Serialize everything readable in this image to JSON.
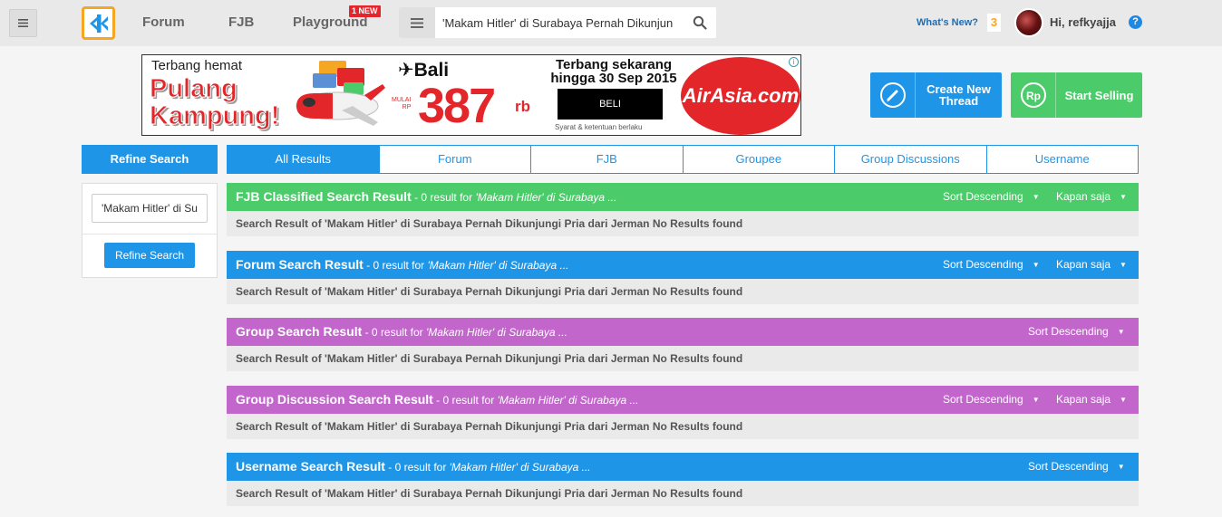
{
  "header": {
    "nav": [
      {
        "label": "Forum"
      },
      {
        "label": "FJB"
      },
      {
        "label": "Playground"
      }
    ],
    "new_badge": "1 NEW",
    "search_value": "'Makam Hitler' di Surabaya Pernah Dikunjun",
    "whats_new": "What's New?",
    "notification_count": "3",
    "greeting": "Hi, refkyajja",
    "help": "?"
  },
  "ad": {
    "tagline": "Terbang hemat",
    "headline_1": "Pulang",
    "headline_2": "Kampung!",
    "destination": "✈Bali",
    "mulai_1": "MULAI",
    "mulai_2": "RP",
    "price": "387",
    "price_unit": "rb",
    "promo_1": "Terbang sekarang",
    "promo_2": "hingga 30 Sep 2015",
    "cta": "BELI",
    "terms": "Syarat & ketentuan berlaku",
    "brand": "AirAsia.com",
    "info": "i"
  },
  "actions": {
    "create_line1": "Create New",
    "create_line2": "Thread",
    "sell": "Start Selling",
    "sell_icon_text": "Rp"
  },
  "sidebar": {
    "header": "Refine Search",
    "input_value": "'Makam Hitler' di Surabaya",
    "button": "Refine Search"
  },
  "tabs": [
    {
      "label": "All Results"
    },
    {
      "label": "Forum"
    },
    {
      "label": "FJB"
    },
    {
      "label": "Groupee"
    },
    {
      "label": "Group Discussions"
    },
    {
      "label": "Username"
    }
  ],
  "sections": [
    {
      "title": "FJB Classified Search Result",
      "meta": " - 0 result for ",
      "query": "'Makam Hitler' di Surabaya ...",
      "sort": "Sort Descending",
      "time": "Kapan saja",
      "body": "Search Result of 'Makam Hitler' di Surabaya Pernah Dikunjungi Pria dari Jerman No Results found"
    },
    {
      "title": "Forum Search Result",
      "meta": " - 0 result for ",
      "query": "'Makam Hitler' di Surabaya ...",
      "sort": "Sort Descending",
      "time": "Kapan saja",
      "body": "Search Result of 'Makam Hitler' di Surabaya Pernah Dikunjungi Pria dari Jerman No Results found"
    },
    {
      "title": "Group Search Result",
      "meta": " - 0 result for ",
      "query": "'Makam Hitler' di Surabaya ...",
      "sort": "Sort Descending",
      "body": "Search Result of 'Makam Hitler' di Surabaya Pernah Dikunjungi Pria dari Jerman No Results found"
    },
    {
      "title": "Group Discussion Search Result",
      "meta": " - 0 result for ",
      "query": "'Makam Hitler' di Surabaya ...",
      "sort": "Sort Descending",
      "time": "Kapan saja",
      "body": "Search Result of 'Makam Hitler' di Surabaya Pernah Dikunjungi Pria dari Jerman No Results found"
    },
    {
      "title": "Username Search Result",
      "meta": " - 0 result for ",
      "query": "'Makam Hitler' di Surabaya ...",
      "sort": "Sort Descending",
      "body": "Search Result of 'Makam Hitler' di Surabaya Pernah Dikunjungi Pria dari Jerman No Results found"
    }
  ],
  "colors": {
    "primary_blue": "#1f95e8",
    "green": "#4ccb6a",
    "purple": "#c266cc",
    "logo_orange": "#f5a623"
  }
}
